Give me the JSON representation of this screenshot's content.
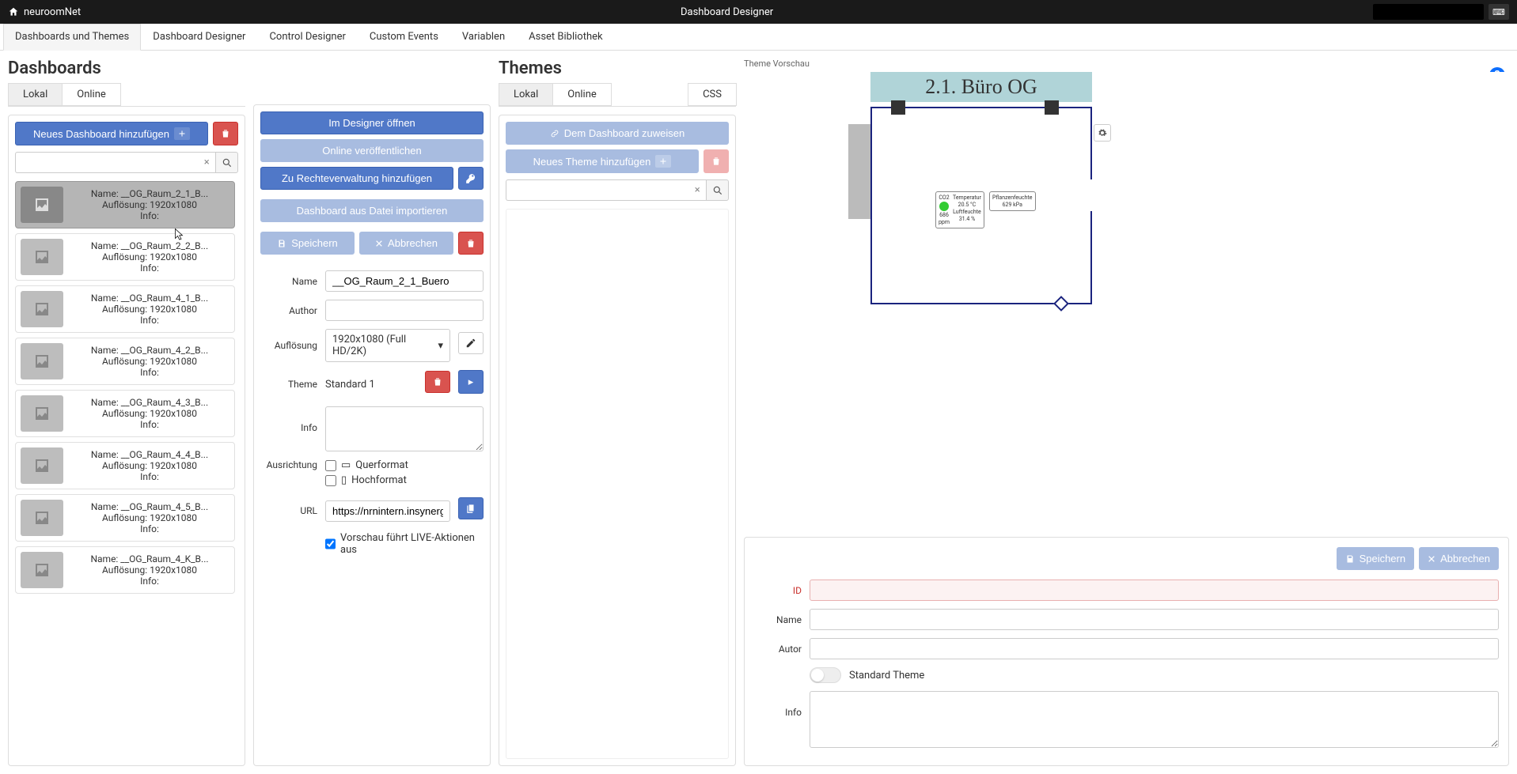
{
  "app": {
    "brand": "neuroomNet",
    "title": "Dashboard Designer"
  },
  "nav": {
    "tabs": [
      "Dashboards und Themes",
      "Dashboard Designer",
      "Control Designer",
      "Custom Events",
      "Variablen",
      "Asset Bibliothek"
    ],
    "active": 0
  },
  "dashboards": {
    "heading": "Dashboards",
    "subtabs": {
      "local": "Lokal",
      "online": "Online",
      "active": "local"
    },
    "add_button": "Neues Dashboard hinzufügen",
    "search_placeholder": "",
    "items": [
      {
        "name": "__OG_Raum_2_1_B...",
        "resolution": "1920x1080",
        "info": "",
        "selected": true
      },
      {
        "name": "__OG_Raum_2_2_B...",
        "resolution": "1920x1080",
        "info": ""
      },
      {
        "name": "__OG_Raum_4_1_B...",
        "resolution": "1920x1080",
        "info": ""
      },
      {
        "name": "__OG_Raum_4_2_B...",
        "resolution": "1920x1080",
        "info": ""
      },
      {
        "name": "__OG_Raum_4_3_B...",
        "resolution": "1920x1080",
        "info": ""
      },
      {
        "name": "__OG_Raum_4_4_B...",
        "resolution": "1920x1080",
        "info": ""
      },
      {
        "name": "__OG_Raum_4_5_B...",
        "resolution": "1920x1080",
        "info": ""
      },
      {
        "name": "__OG_Raum_4_K_B...",
        "resolution": "1920x1080",
        "info": ""
      }
    ],
    "labels": {
      "name": "Name:",
      "resolution": "Auflösung:",
      "info": "Info:"
    }
  },
  "editor": {
    "buttons": {
      "open": "Im Designer öffnen",
      "publish": "Online veröffentlichen",
      "rights": "Zu Rechteverwaltung hinzufügen",
      "import": "Dashboard aus Datei importieren",
      "save": "Speichern",
      "cancel": "Abbrechen"
    },
    "form": {
      "name_label": "Name",
      "name_value": "__OG_Raum_2_1_Buero",
      "author_label": "Author",
      "author_value": "",
      "resolution_label": "Auflösung",
      "resolution_value": "1920x1080 (Full HD/2K)",
      "theme_label": "Theme",
      "theme_value": "Standard 1",
      "info_label": "Info",
      "info_value": "",
      "orientation_label": "Ausrichtung",
      "landscape": "Querformat",
      "portrait": "Hochformat",
      "url_label": "URL",
      "url_value": "https://nrnintern.insynergie.lo",
      "live_preview": "Vorschau führt LIVE-Aktionen aus"
    }
  },
  "themes": {
    "heading": "Themes",
    "subtabs": {
      "local": "Lokal",
      "online": "Online",
      "css": "CSS",
      "active": "local"
    },
    "assign_button": "Dem Dashboard zuweisen",
    "add_button": "Neues Theme hinzufügen",
    "search_placeholder": ""
  },
  "preview": {
    "header": "Theme Vorschau",
    "room_title": "2.1. Büro OG",
    "sensor": {
      "co2_label": "CO2",
      "co2_value": "686",
      "co2_unit": "ppm",
      "temp_label": "Temperatur",
      "temp_value": "20.5 °C",
      "hum_label": "Luftfeuchte",
      "hum_value": "31.4 %",
      "plant_label": "Pflanzenfeuchte",
      "plant_value": "629 kPa"
    }
  },
  "theme_form": {
    "save": "Speichern",
    "cancel": "Abbrechen",
    "id_label": "ID",
    "id_value": "",
    "name_label": "Name",
    "name_value": "",
    "author_label": "Autor",
    "author_value": "",
    "standard": "Standard Theme",
    "info_label": "Info",
    "info_value": ""
  }
}
